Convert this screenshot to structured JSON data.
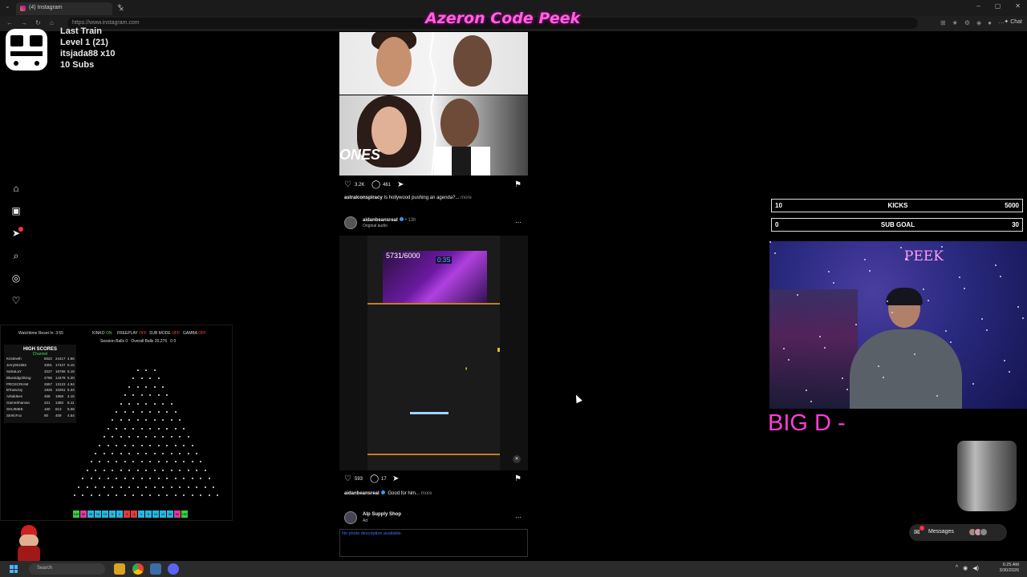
{
  "browser": {
    "tab_title": "(4) Instagram",
    "url": "https://www.instagram.com",
    "chat_label": "Chat"
  },
  "overlay": {
    "title": "Azeron Code Peek"
  },
  "train": {
    "line1": "Last Train",
    "line2": "Level 1  (21)",
    "line3": "itsjada88 x10",
    "line4": "10 Subs"
  },
  "sidebar": {
    "items": [
      "home-icon",
      "reels-icon",
      "send-icon",
      "search-icon",
      "explore-icon",
      "heart-icon"
    ],
    "notification_count": "4"
  },
  "plinko": {
    "watchtime": "Watchtime Reset In: 3:55",
    "flags": [
      {
        "label": "KINKO",
        "state": "ON",
        "on": true
      },
      {
        "label": "FREEPLAY",
        "state": "OFF",
        "on": false
      },
      {
        "label": "SUB MODE",
        "state": "OFF",
        "on": false
      },
      {
        "label": "GAMBA",
        "state": "OFF",
        "on": false
      }
    ],
    "session_balls": "Session Balls   0",
    "overall_balls": "Overall Balls   20,276",
    "extra": "0    0",
    "high_scores_title": "HIGH SCORES",
    "high_scores_sub": "Channel",
    "scores": [
      [
        "Kristineth",
        "5022",
        "24417",
        "4.86"
      ],
      [
        "Jerry051982",
        "3301",
        "17427",
        "5.15"
      ],
      [
        "SaSaLaY",
        "3227",
        "16766",
        "5.18"
      ],
      [
        "Bluestdgchking",
        "2785",
        "14478",
        "5.20"
      ],
      [
        "PROSCRIAM",
        "2657",
        "13123",
        "4.94"
      ],
      [
        "BTowsJoy",
        "1925",
        "10251",
        "5.33"
      ],
      [
        "Arkaldees",
        "458",
        "1868",
        "4.15"
      ],
      [
        "GameShaman",
        "221",
        "1350",
        "6.11"
      ],
      [
        "SHIJIMEE",
        "160",
        "813",
        "5.08"
      ],
      [
        "StrelcFox",
        "90",
        "409",
        "4.54"
      ]
    ],
    "slots": [
      "100",
      "50",
      "25",
      "10",
      "10",
      "5",
      "1",
      "-1",
      "-1",
      "1",
      "5",
      "10",
      "10",
      "25",
      "50",
      "100"
    ]
  },
  "feed": {
    "post1": {
      "likes": "3.2K",
      "comments": "461",
      "caption_user": "astralconspiracy",
      "caption_text": "Is hollywood pushing an agenda?...",
      "more": "more",
      "image_text": "ONES"
    },
    "post2": {
      "username": "aidanbeansreal",
      "time": "• 13h",
      "audio": "Original audio",
      "video_score": "5731/6000",
      "video_timer": "0:3S",
      "likes": "593",
      "comments": "17",
      "caption_user": "aidanbeansreal",
      "caption_text": "Good for him...",
      "more": "more"
    },
    "post3": {
      "username": "Alp Supply Shop",
      "sub": "Ad",
      "alt_text": "No photo description available."
    }
  },
  "right": {
    "kicks": {
      "lo": "10",
      "label": "KICKS",
      "hi": "5000"
    },
    "subgoal": {
      "lo": "0",
      "label": "SUB GOAL",
      "hi": "30"
    },
    "webcam_label": "PEEK",
    "big_d": "BIG D -",
    "messages_label": "Messages"
  },
  "taskbar": {
    "search_placeholder": "Search",
    "time": "6:25 AM",
    "date": "3/30/2026"
  }
}
